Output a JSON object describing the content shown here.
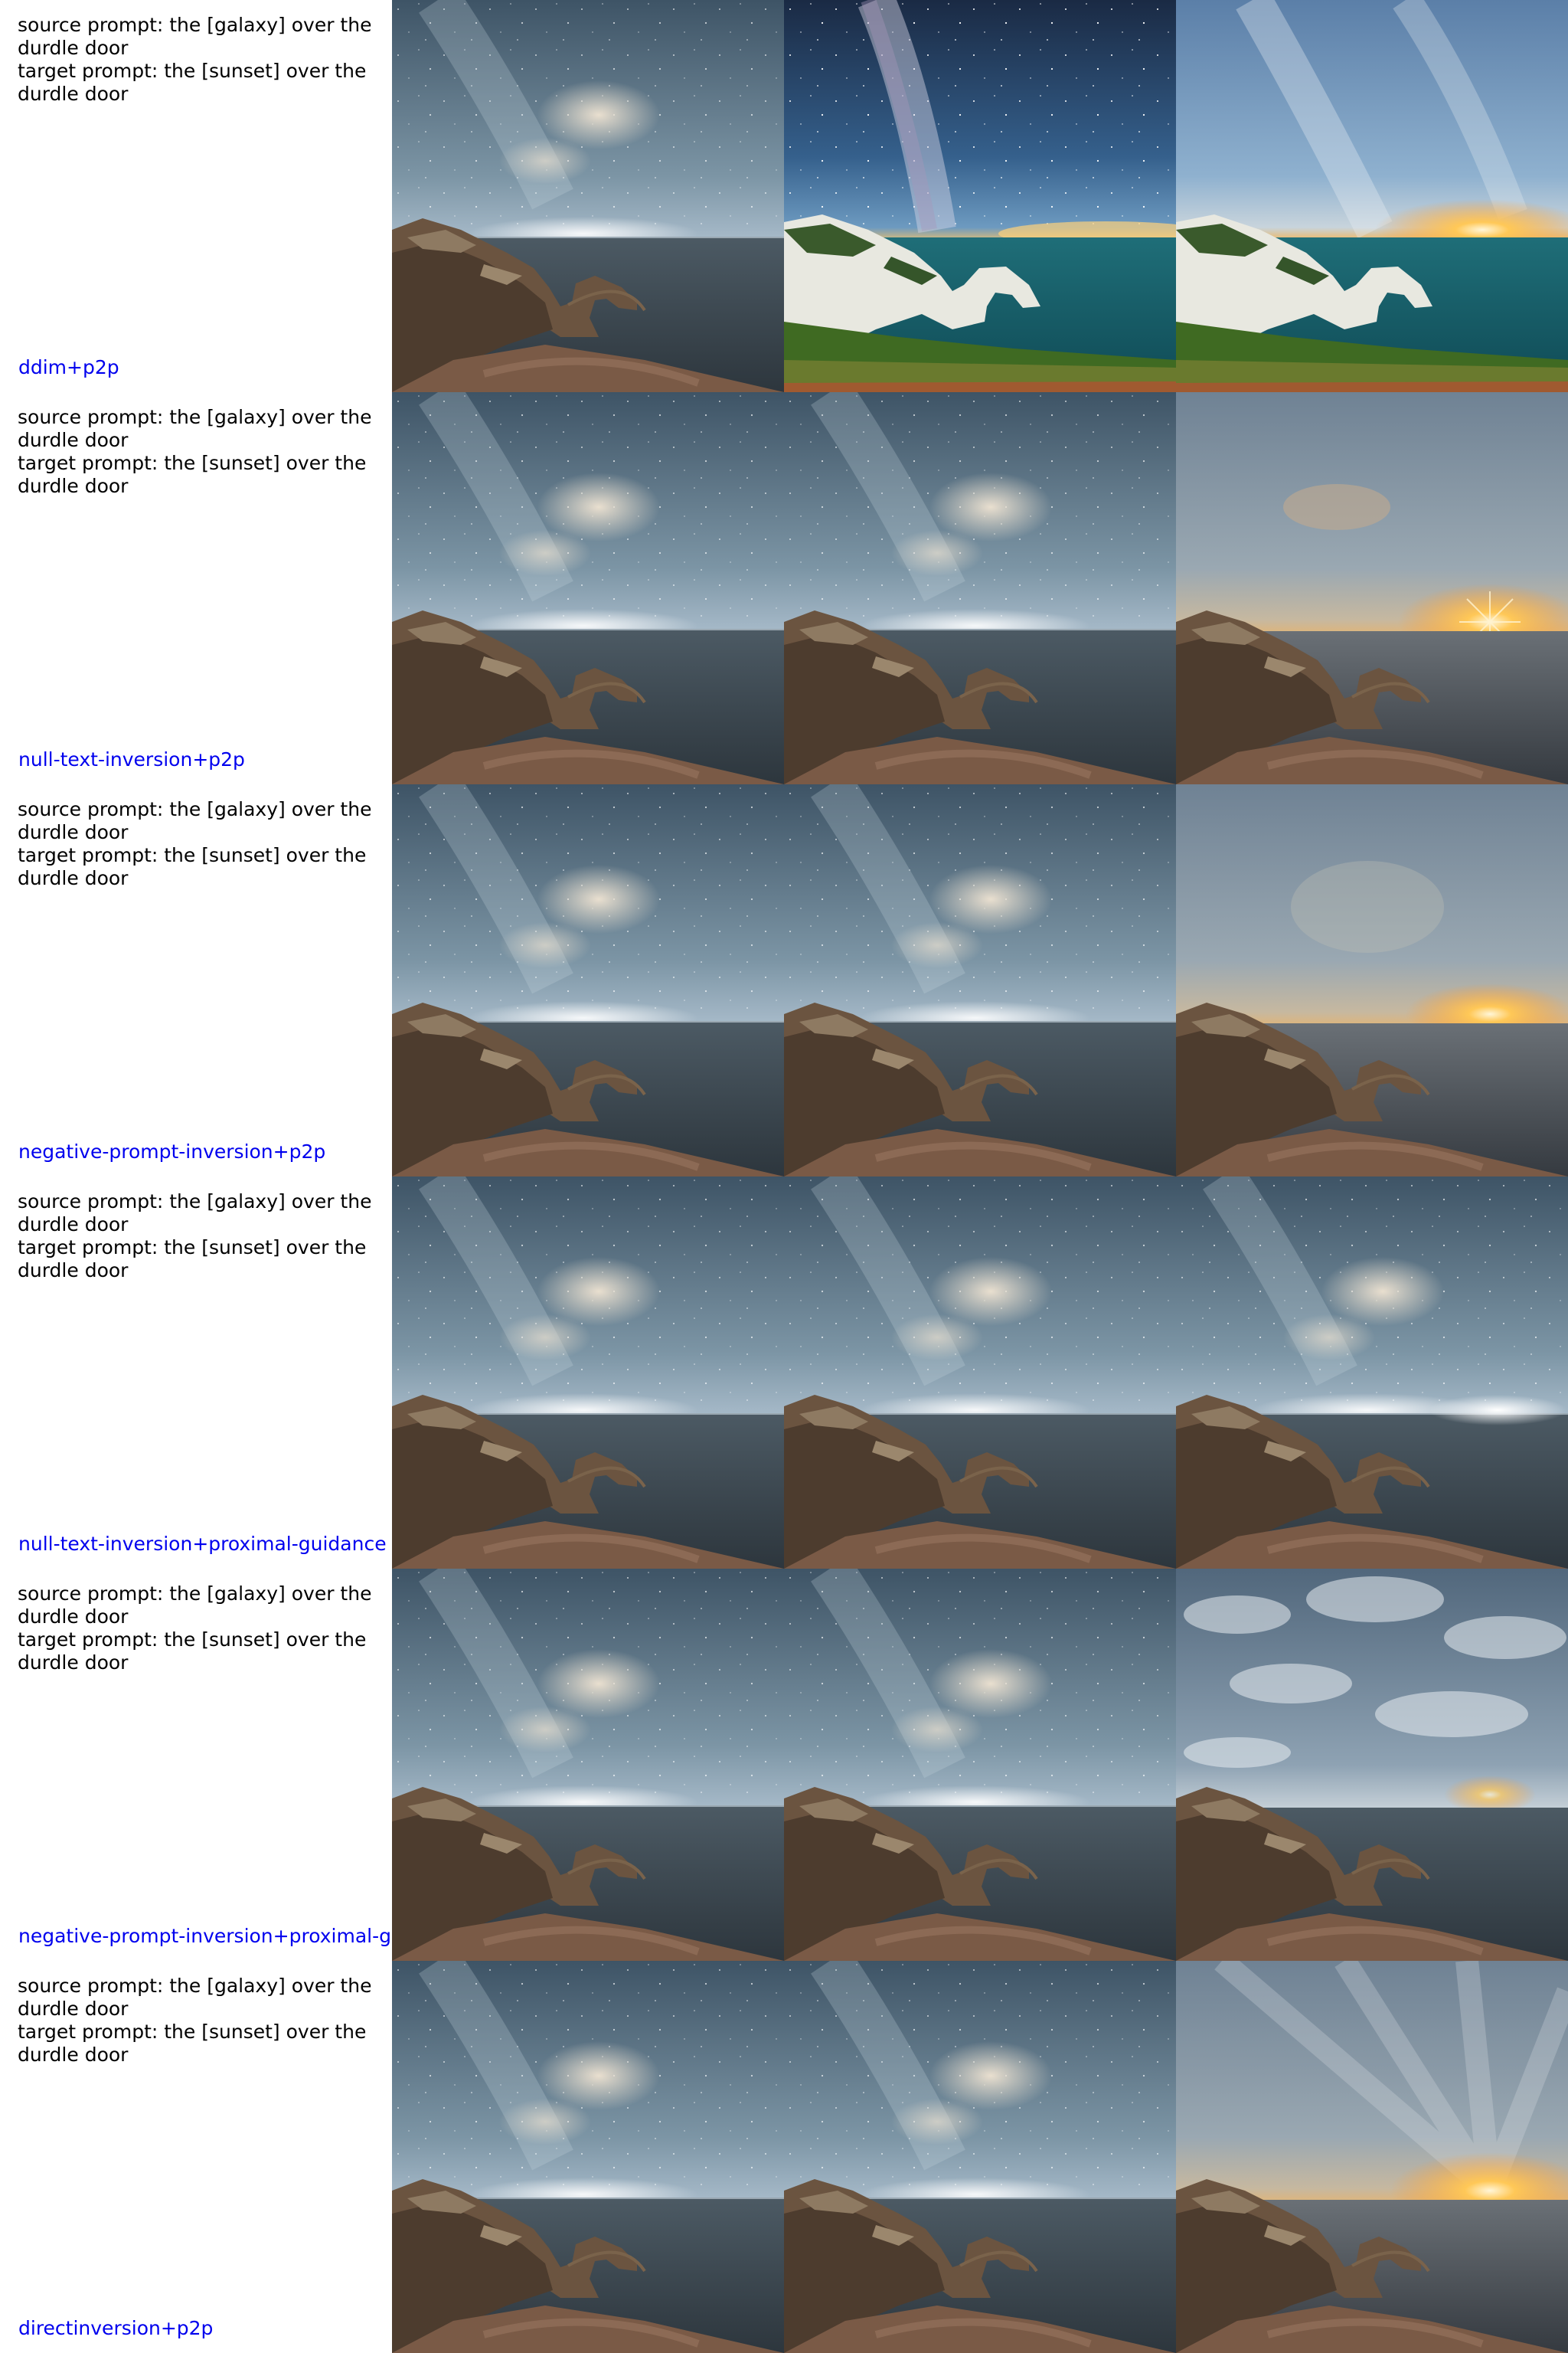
{
  "accent_color": "#0000ee",
  "rows": [
    {
      "source_prompt": "source prompt: the [galaxy] over the durdle door",
      "target_prompt": "target prompt: the [sunset] over the durdle door",
      "method": "ddim+p2p",
      "images": [
        "source photo of Durdle Door under a galaxy sky",
        "reconstruction: vivid milky way over green cliffs and arch",
        "edit: bright sunset over green cliffs and arch"
      ]
    },
    {
      "source_prompt": "source prompt: the [galaxy] over the durdle door",
      "target_prompt": "target prompt: the [sunset] over the durdle door",
      "method": "null-text-inversion+p2p",
      "images": [
        "source photo",
        "reconstruction",
        "edit: sunset with starburst over the sea"
      ]
    },
    {
      "source_prompt": "source prompt: the [galaxy] over the durdle door",
      "target_prompt": "target prompt: the [sunset] over the durdle door",
      "method": "negative-prompt-inversion+p2p",
      "images": [
        "source photo",
        "reconstruction",
        "edit: hazy sunset over the sea"
      ]
    },
    {
      "source_prompt": "source prompt: the [galaxy] over the durdle door",
      "target_prompt": "target prompt: the [sunset] over the durdle door",
      "method": "null-text-inversion+proximal-guidance",
      "images": [
        "source photo",
        "reconstruction",
        "edit: galaxy sky with brighter horizon"
      ]
    },
    {
      "source_prompt": "source prompt: the [galaxy] over the durdle door",
      "target_prompt": "target prompt: the [sunset] over the durdle door",
      "method": "negative-prompt-inversion+proximal-g",
      "images": [
        "source photo",
        "reconstruction",
        "edit: cloudy sky with faint sun"
      ]
    },
    {
      "source_prompt": "source prompt: the [galaxy] over the durdle door",
      "target_prompt": "target prompt: the [sunset] over the durdle door",
      "method": "directinversion+p2p",
      "images": [
        "source photo",
        "reconstruction",
        "edit: warm sunset with light rays"
      ]
    }
  ]
}
